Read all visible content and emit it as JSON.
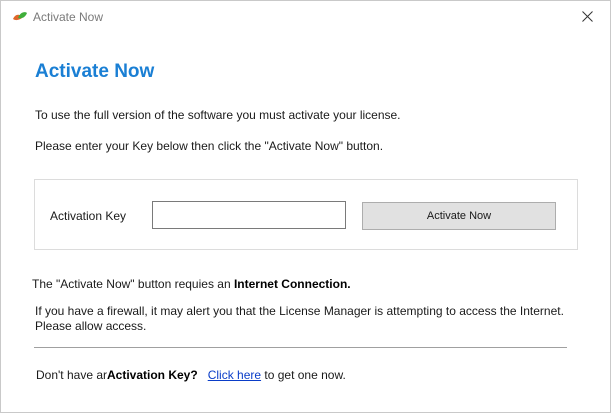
{
  "window": {
    "title": "Activate Now",
    "close_glyph": "✕"
  },
  "main": {
    "heading": "Activate Now",
    "intro_line1": "To use the full version of the software you must activate your license.",
    "intro_line2": "Please enter your Key below then click the \"Activate Now\" button."
  },
  "key_panel": {
    "label": "Activation Key",
    "input_value": "",
    "button_label": "Activate Now"
  },
  "requirement": {
    "prefix": "The \"Activate Now\" button requies an ",
    "bold": "Internet Connection."
  },
  "firewall_note": "If you have a firewall, it may alert you that the License Manager is attempting to access the Internet. Please allow access.",
  "footer": {
    "prefix": "Don't have ar",
    "bold": "Activation Key?",
    "link": "Click here",
    "suffix": " to get one now."
  },
  "icons": {
    "app_icon": "leaf-logo-icon",
    "close_icon": "close-icon"
  },
  "colors": {
    "heading": "#1a7fd4",
    "link": "#0a3dc8",
    "button_bg": "#e1e1e1"
  }
}
